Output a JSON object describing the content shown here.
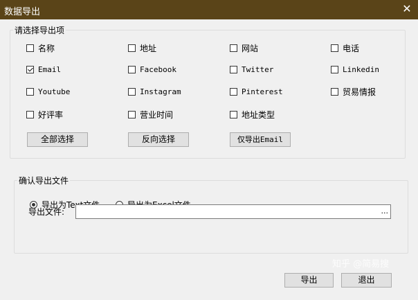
{
  "window": {
    "title": "数据导出",
    "close_glyph": "✕"
  },
  "select_group": {
    "legend": "请选择导出项",
    "rows": [
      [
        {
          "label": "名称",
          "checked": false
        },
        {
          "label": "地址",
          "checked": false
        },
        {
          "label": "网站",
          "checked": false
        },
        {
          "label": "电话",
          "checked": false
        }
      ],
      [
        {
          "label": "Email",
          "checked": true
        },
        {
          "label": "Facebook",
          "checked": false
        },
        {
          "label": "Twitter",
          "checked": false
        },
        {
          "label": "Linkedin",
          "checked": false
        }
      ],
      [
        {
          "label": "Youtube",
          "checked": false
        },
        {
          "label": "Instagram",
          "checked": false
        },
        {
          "label": "Pinterest",
          "checked": false
        },
        {
          "label": "贸易情报",
          "checked": false
        }
      ],
      [
        {
          "label": "好评率",
          "checked": false
        },
        {
          "label": "营业时间",
          "checked": false
        },
        {
          "label": "地址类型",
          "checked": false
        }
      ]
    ],
    "buttons": {
      "select_all": "全部选择",
      "invert": "反向选择",
      "email_only": "仅导出Email"
    }
  },
  "file_group": {
    "legend": "确认导出文件",
    "radio_text": {
      "label": "导出为Text文件",
      "selected": true
    },
    "radio_excel": {
      "label": "导出为Excel文件",
      "selected": false
    },
    "file_label": "导出文件:",
    "file_value": "",
    "browse_label": "..."
  },
  "footer": {
    "export_label": "导出",
    "exit_label": "退出"
  },
  "watermark": "知乎 @简易搜"
}
